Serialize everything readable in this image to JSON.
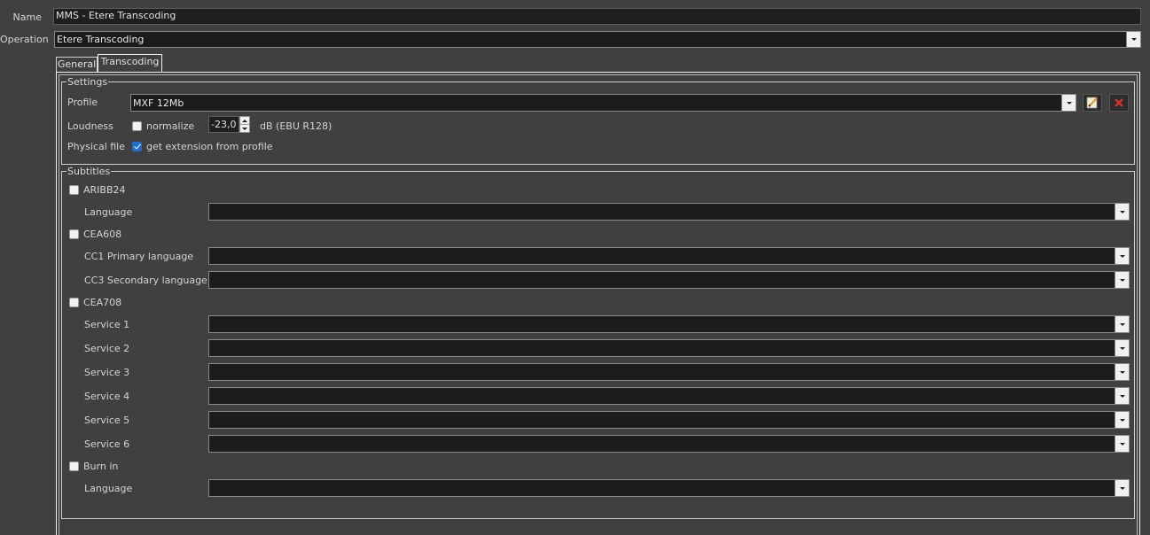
{
  "fields": {
    "name_label": "Name",
    "name_value": "MMS - Etere Transcoding",
    "operation_label": "Operation",
    "operation_value": "Etere Transcoding"
  },
  "tabs": [
    {
      "label": "General",
      "active": false
    },
    {
      "label": "Transcoding",
      "active": true
    }
  ],
  "settings": {
    "title": "Settings",
    "profile_label": "Profile",
    "profile_value": "MXF 12Mb",
    "edit_icon": "edit-icon",
    "delete_icon": "delete-icon",
    "loudness_label": "Loudness",
    "normalize_label": "normalize",
    "normalize_checked": false,
    "loudness_value": "-23,0",
    "loudness_unit": "dB (EBU R128)",
    "physical_file_label": "Physical file",
    "extension_label": "get extension from profile",
    "extension_checked": true
  },
  "subtitles": {
    "title": "Subtitles",
    "aribb24": {
      "label": "ARIBB24",
      "checked": false,
      "language_label": "Language",
      "language_value": ""
    },
    "cea608": {
      "label": "CEA608",
      "checked": false,
      "cc1_label": "CC1 Primary language",
      "cc1_value": "",
      "cc3_label": "CC3 Secondary language",
      "cc3_value": ""
    },
    "cea708": {
      "label": "CEA708",
      "checked": false,
      "services": [
        {
          "label": "Service 1",
          "value": ""
        },
        {
          "label": "Service 2",
          "value": ""
        },
        {
          "label": "Service 3",
          "value": ""
        },
        {
          "label": "Service 4",
          "value": ""
        },
        {
          "label": "Service 5",
          "value": ""
        },
        {
          "label": "Service 6",
          "value": ""
        }
      ]
    },
    "burnin": {
      "label": "Burn in",
      "checked": false,
      "language_label": "Language",
      "language_value": ""
    }
  }
}
